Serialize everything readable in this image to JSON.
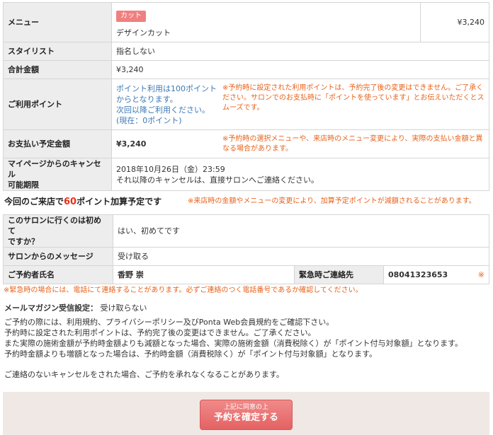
{
  "menu": {
    "label": "メニュー",
    "tag": "カット",
    "name": "デザインカット",
    "price": "¥3,240"
  },
  "stylist": {
    "label": "スタイリスト",
    "value": "指名しない"
  },
  "total": {
    "label": "合計金額",
    "value": "¥3,240"
  },
  "points": {
    "label": "ご利用ポイント",
    "line1": "ポイント利用は100ポイント",
    "line2": "からとなります。",
    "line3": "次回以降ご利用ください。",
    "line4": "(現在：0ポイント)",
    "note": "※予約時に設定された利用ポイントは、予約完了後の変更はできません。ご了承ください。サロンでのお支払時に「ポイントを使っています」とお伝えいただくとスムーズです。"
  },
  "payment": {
    "label": "お支払い予定金額",
    "value": "¥3,240",
    "note": "※予約時の選択メニューや、来店時のメニュー変更により、実際の支払い金額と異なる場合があります。"
  },
  "cancel_deadline": {
    "label_line1": "マイページからのキャンセル",
    "label_line2": "可能期限",
    "line1": "2018年10月26日（金）23:59",
    "line2": "それ以降のキャンセルは、直接サロンへご連絡ください。"
  },
  "summary": {
    "prefix": "今回のご来店で",
    "points": "60",
    "suffix": "ポイント加算予定です",
    "note": "※来店時の金額やメニューの変更により、加算予定ポイントが減額されることがあります。"
  },
  "first_visit": {
    "label_line1": "このサロンに行くのは初めて",
    "label_line2": "ですか？",
    "value": "はい、初めてです"
  },
  "salon_message": {
    "label": "サロンからのメッセージ",
    "value": "受け取る"
  },
  "customer": {
    "name_label": "ご予約者氏名",
    "name_value": "香野 崇",
    "emergency_label": "緊急時ご連絡先",
    "emergency_value": "08041323653",
    "emergency_mark": "※"
  },
  "emergency_note": "※緊急時の場合には、電話にて連絡することがあります。必ずご連絡のつく電話番号であるか確認してください。",
  "mail_magazine": {
    "label": "メールマガジン受信設定：",
    "value": "受け取らない"
  },
  "terms": {
    "line1": "ご予約の際には、利用規約、プライバシーポリシー及びPonta Web会員規約をご確認下さい。",
    "line2": "予約時に設定された利用ポイントは、予約完了後の変更はできません。ご了承ください。",
    "line3": "また実際の施術金額が予約時金額よりも減額となった場合、実際の施術金額（消費税除く）が「ポイント付与対象額」となります。",
    "line4": "予約時金額よりも増額となった場合は、予約時金額（消費税除く）が「ポイント付与対象額」となります。"
  },
  "cancel_notice": "ご連絡のないキャンセルをされた場合、ご予約を承れなくなることがあります。",
  "confirm_button": {
    "small": "上記に同意の上",
    "big": "予約を確定する"
  },
  "colors": {
    "accent": "#e46262",
    "note": "#e8621a",
    "link": "#3c78b4",
    "label_bg": "#ededed"
  }
}
